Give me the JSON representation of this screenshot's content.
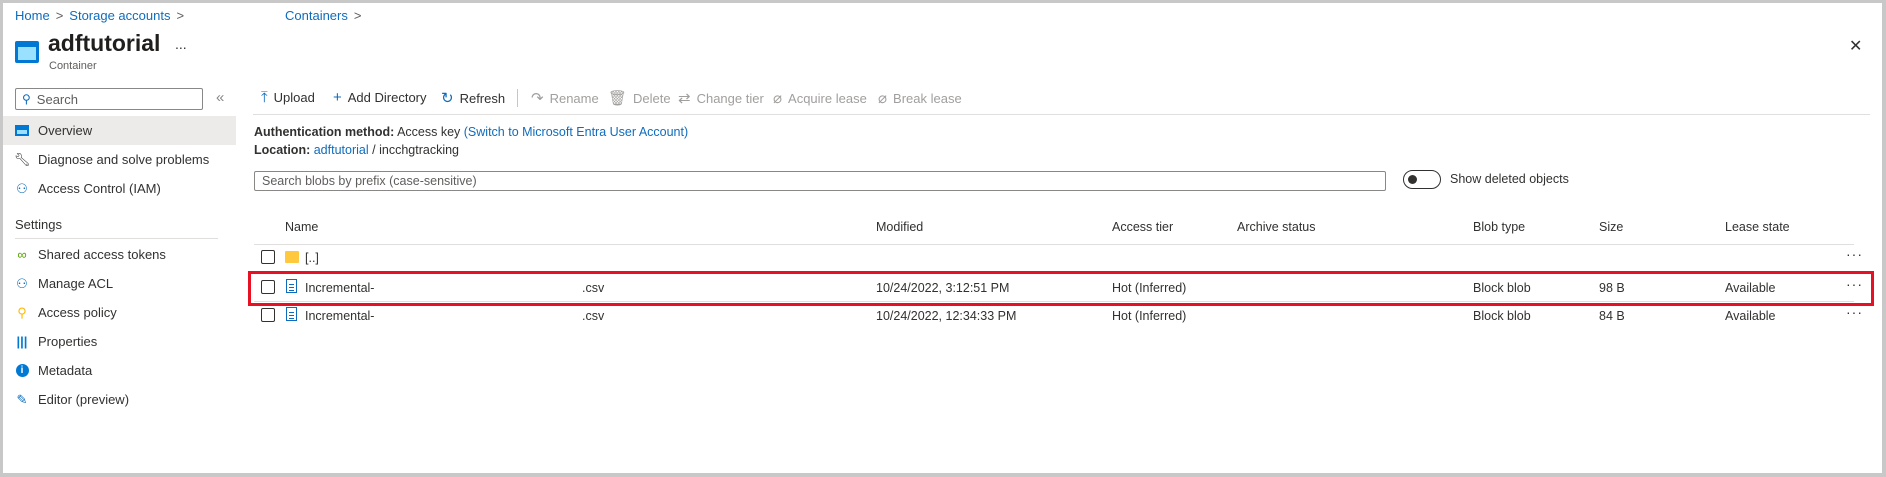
{
  "breadcrumb": {
    "items": [
      "Home",
      "Storage accounts",
      "Containers"
    ]
  },
  "header": {
    "title": "adftutorial",
    "subtitle": "Container",
    "more": "...",
    "close": "✕"
  },
  "sidebar": {
    "search_placeholder": "Search",
    "collapse": "«",
    "items": [
      {
        "label": "Overview",
        "icon": "container-icon"
      },
      {
        "label": "Diagnose and solve problems",
        "icon": "wrench-icon"
      },
      {
        "label": "Access Control (IAM)",
        "icon": "people-icon"
      }
    ],
    "section": "Settings",
    "settings": [
      {
        "label": "Shared access tokens",
        "icon": "link-icon"
      },
      {
        "label": "Manage ACL",
        "icon": "people-icon"
      },
      {
        "label": "Access policy",
        "icon": "key-icon"
      },
      {
        "label": "Properties",
        "icon": "properties-icon"
      },
      {
        "label": "Metadata",
        "icon": "info-icon"
      },
      {
        "label": "Editor (preview)",
        "icon": "pencil-icon"
      }
    ]
  },
  "toolbar": {
    "upload": "Upload",
    "add_directory": "Add Directory",
    "refresh": "Refresh",
    "rename": "Rename",
    "delete": "Delete",
    "change_tier": "Change tier",
    "acquire_lease": "Acquire lease",
    "break_lease": "Break lease"
  },
  "info": {
    "auth_label": "Authentication method:",
    "auth_value": "Access key",
    "auth_switch": "(Switch to Microsoft Entra User Account)",
    "location_label": "Location:",
    "location_link": "adftutorial",
    "location_sep": "/",
    "location_path": "incchgtracking"
  },
  "search": {
    "placeholder": "Search blobs by prefix (case-sensitive)"
  },
  "toggle": {
    "label": "Show deleted objects",
    "on": false
  },
  "table": {
    "columns": [
      "Name",
      "Modified",
      "Access tier",
      "Archive status",
      "Blob type",
      "Size",
      "Lease state"
    ],
    "rows": [
      {
        "name": "[..]",
        "type": "folder",
        "modified": "",
        "tier": "",
        "archive": "",
        "blob_type": "",
        "size": "",
        "lease": ""
      },
      {
        "name": "Incremental-",
        "suffix": ".csv",
        "type": "file",
        "modified": "10/24/2022, 3:12:51 PM",
        "tier": "Hot (Inferred)",
        "archive": "",
        "blob_type": "Block blob",
        "size": "98 B",
        "lease": "Available",
        "highlighted": true
      },
      {
        "name": "Incremental-",
        "suffix": ".csv",
        "type": "file",
        "modified": "10/24/2022, 12:34:33 PM",
        "tier": "Hot (Inferred)",
        "archive": "",
        "blob_type": "Block blob",
        "size": "84 B",
        "lease": "Available"
      }
    ],
    "more": "···"
  },
  "colors": {
    "accent": "#0f6cbd",
    "highlight": "#e81123",
    "folder": "#ffc83d"
  }
}
